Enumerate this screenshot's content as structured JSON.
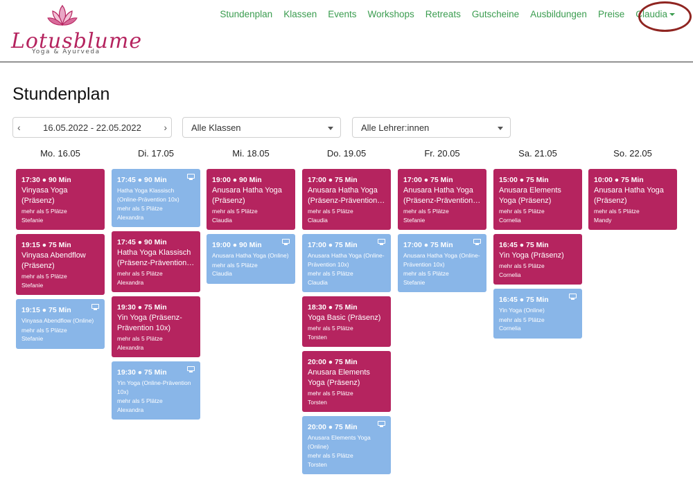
{
  "brand": {
    "name": "Lotusblume",
    "tagline": "Yoga & Ayurveda"
  },
  "colors": {
    "accent_green": "#3a9c4f",
    "presence": "#b5245f",
    "online": "#89b6e8",
    "highlight_circle": "#8f2521"
  },
  "nav": {
    "items": [
      "Stundenplan",
      "Klassen",
      "Events",
      "Workshops",
      "Retreats",
      "Gutscheine",
      "Ausbildungen",
      "Preise"
    ],
    "user": "Claudia"
  },
  "page": {
    "title": "Stundenplan"
  },
  "filters": {
    "date_range": "16.05.2022 - 22.05.2022",
    "classes": "Alle Klassen",
    "teachers": "Alle Lehrer:innen"
  },
  "days": [
    {
      "label": "Mo. 16.05",
      "classes": [
        {
          "time": "17:30 ● 90 Min",
          "name": "Vinyasa Yoga (Präsenz)",
          "slots": "mehr als 5 Plätze",
          "teacher": "Stefanie",
          "online": false
        },
        {
          "time": "19:15 ● 75 Min",
          "name": "Vinyasa Abendflow (Präsenz)",
          "slots": "mehr als 5 Plätze",
          "teacher": "Stefanie",
          "online": false
        },
        {
          "time": "19:15 ● 75 Min",
          "name": "Vinyasa Abendflow (Online)",
          "slots": "mehr als 5 Plätze",
          "teacher": "Stefanie",
          "online": true
        }
      ]
    },
    {
      "label": "Di. 17.05",
      "classes": [
        {
          "time": "17:45 ● 90 Min",
          "name": "Hatha Yoga Klassisch (Online-Prävention 10x)",
          "slots": "mehr als 5 Plätze",
          "teacher": "Alexandra",
          "online": true
        },
        {
          "time": "17:45 ● 90 Min",
          "name": "Hatha Yoga Klassisch (Präsenz-Prävention…",
          "slots": "mehr als 5 Plätze",
          "teacher": "Alexandra",
          "online": false
        },
        {
          "time": "19:30 ● 75 Min",
          "name": "Yin Yoga (Präsenz-Prävention 10x)",
          "slots": "mehr als 5 Plätze",
          "teacher": "Alexandra",
          "online": false
        },
        {
          "time": "19:30 ● 75 Min",
          "name": "Yin Yoga (Online-Prävention 10x)",
          "slots": "mehr als 5 Plätze",
          "teacher": "Alexandra",
          "online": true
        }
      ]
    },
    {
      "label": "Mi. 18.05",
      "classes": [
        {
          "time": "19:00 ● 90 Min",
          "name": "Anusara Hatha Yoga (Präsenz)",
          "slots": "mehr als 5 Plätze",
          "teacher": "Claudia",
          "online": false
        },
        {
          "time": "19:00 ● 90 Min",
          "name": "Anusara Hatha Yoga (Online)",
          "slots": "mehr als 5 Plätze",
          "teacher": "Claudia",
          "online": true
        }
      ]
    },
    {
      "label": "Do. 19.05",
      "classes": [
        {
          "time": "17:00 ● 75 Min",
          "name": "Anusara Hatha Yoga (Präsenz-Prävention…",
          "slots": "mehr als 5 Plätze",
          "teacher": "Claudia",
          "online": false
        },
        {
          "time": "17:00 ● 75 Min",
          "name": "Anusara Hatha Yoga (Online-Prävention 10x)",
          "slots": "mehr als 5 Plätze",
          "teacher": "Claudia",
          "online": true
        },
        {
          "time": "18:30 ● 75 Min",
          "name": "Yoga Basic (Präsenz)",
          "slots": "mehr als 5 Plätze",
          "teacher": "Torsten",
          "online": false
        },
        {
          "time": "20:00 ● 75 Min",
          "name": "Anusara Elements Yoga (Präsenz)",
          "slots": "mehr als 5 Plätze",
          "teacher": "Torsten",
          "online": false
        },
        {
          "time": "20:00 ● 75 Min",
          "name": "Anusara Elements Yoga (Online)",
          "slots": "mehr als 5 Plätze",
          "teacher": "Torsten",
          "online": true
        }
      ]
    },
    {
      "label": "Fr. 20.05",
      "classes": [
        {
          "time": "17:00 ● 75 Min",
          "name": "Anusara Hatha Yoga (Präsenz-Prävention…",
          "slots": "mehr als 5 Plätze",
          "teacher": "Stefanie",
          "online": false
        },
        {
          "time": "17:00 ● 75 Min",
          "name": "Anusara Hatha Yoga (Online-Prävention 10x)",
          "slots": "mehr als 5 Plätze",
          "teacher": "Stefanie",
          "online": true
        }
      ]
    },
    {
      "label": "Sa. 21.05",
      "classes": [
        {
          "time": "15:00 ● 75 Min",
          "name": "Anusara Elements Yoga (Präsenz)",
          "slots": "mehr als 5 Plätze",
          "teacher": "Cornelia",
          "online": false
        },
        {
          "time": "16:45 ● 75 Min",
          "name": "Yin Yoga (Präsenz)",
          "slots": "mehr als 5 Plätze",
          "teacher": "Cornelia",
          "online": false
        },
        {
          "time": "16:45 ● 75 Min",
          "name": "Yin Yoga (Online)",
          "slots": "mehr als 5 Plätze",
          "teacher": "Cornelia",
          "online": true
        }
      ]
    },
    {
      "label": "So. 22.05",
      "classes": [
        {
          "time": "10:00 ● 75 Min",
          "name": "Anusara Hatha Yoga (Präsenz)",
          "slots": "mehr als 5 Plätze",
          "teacher": "Mandy",
          "online": false
        }
      ]
    }
  ]
}
